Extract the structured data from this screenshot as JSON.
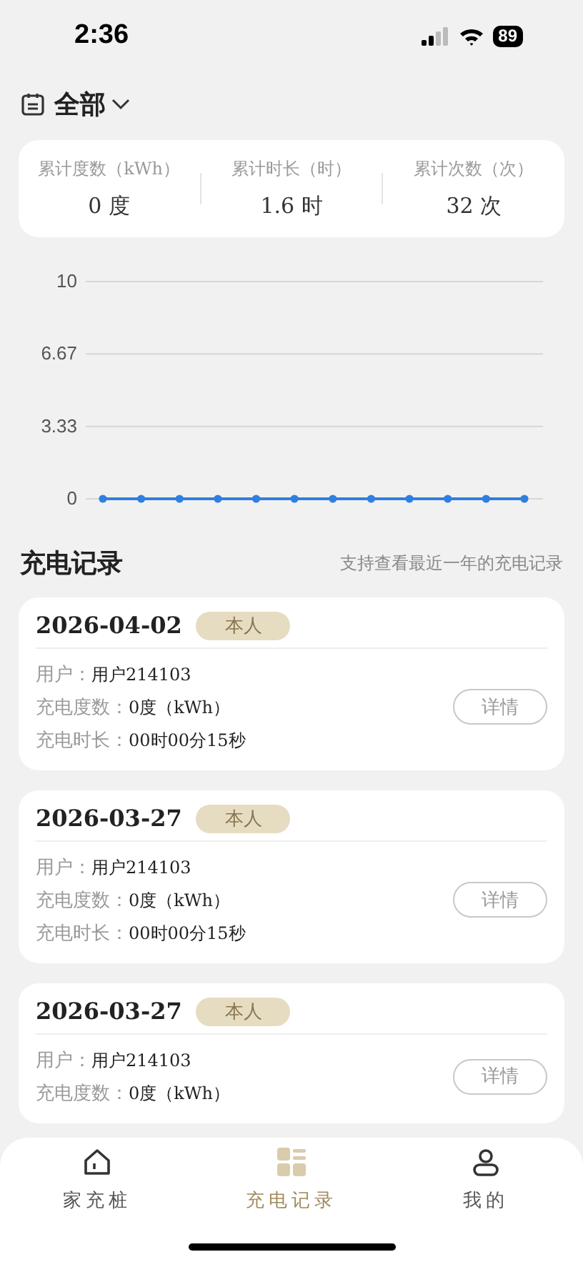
{
  "status_bar": {
    "time": "2:36",
    "battery": "89"
  },
  "filter": {
    "label": "全部"
  },
  "stats": [
    {
      "label": "累计度数（kWh）",
      "value": "0 度"
    },
    {
      "label": "累计时长（时）",
      "value": "1.6 时"
    },
    {
      "label": "累计次数（次）",
      "value": "32 次"
    }
  ],
  "chart": {
    "chart_data": {
      "type": "line",
      "series": [
        {
          "color": "#2f7fe0",
          "marker": true,
          "values": [
            0,
            0,
            0,
            0,
            0,
            0,
            0,
            0,
            0,
            0,
            0,
            0
          ]
        }
      ],
      "ylim": [
        0,
        10
      ],
      "yticks": [
        0,
        {
          "value": 3.33,
          "label": "3.33"
        },
        {
          "value": 6.67,
          "label": "6.67"
        },
        10
      ]
    }
  },
  "records_header": {
    "title": "充电记录",
    "note": "支持查看最近一年的充电记录"
  },
  "records": [
    {
      "date": "2026-04-02",
      "tag": "本人",
      "button": "详情",
      "fields": [
        {
          "label": "用户：",
          "value": "用户214103"
        },
        {
          "label": "充电度数：",
          "value": "0度（kWh）"
        },
        {
          "label": "充电时长：",
          "value": "00时00分15秒"
        }
      ]
    },
    {
      "date": "2026-03-27",
      "tag": "本人",
      "button": "详情",
      "fields": [
        {
          "label": "用户：",
          "value": "用户214103"
        },
        {
          "label": "充电度数：",
          "value": "0度（kWh）"
        },
        {
          "label": "充电时长：",
          "value": "00时00分15秒"
        }
      ]
    },
    {
      "date": "2026-03-27",
      "tag": "本人",
      "button": "详情",
      "fields": [
        {
          "label": "用户：",
          "value": "用户214103"
        },
        {
          "label": "充电度数：",
          "value": "0度（kWh）"
        }
      ]
    }
  ],
  "tab_bar": [
    {
      "kind": "home",
      "label": "家充桩",
      "selected": false
    },
    {
      "kind": "records",
      "label": "充电记录",
      "selected": true
    },
    {
      "kind": "profile",
      "label": "我的",
      "selected": false
    }
  ]
}
